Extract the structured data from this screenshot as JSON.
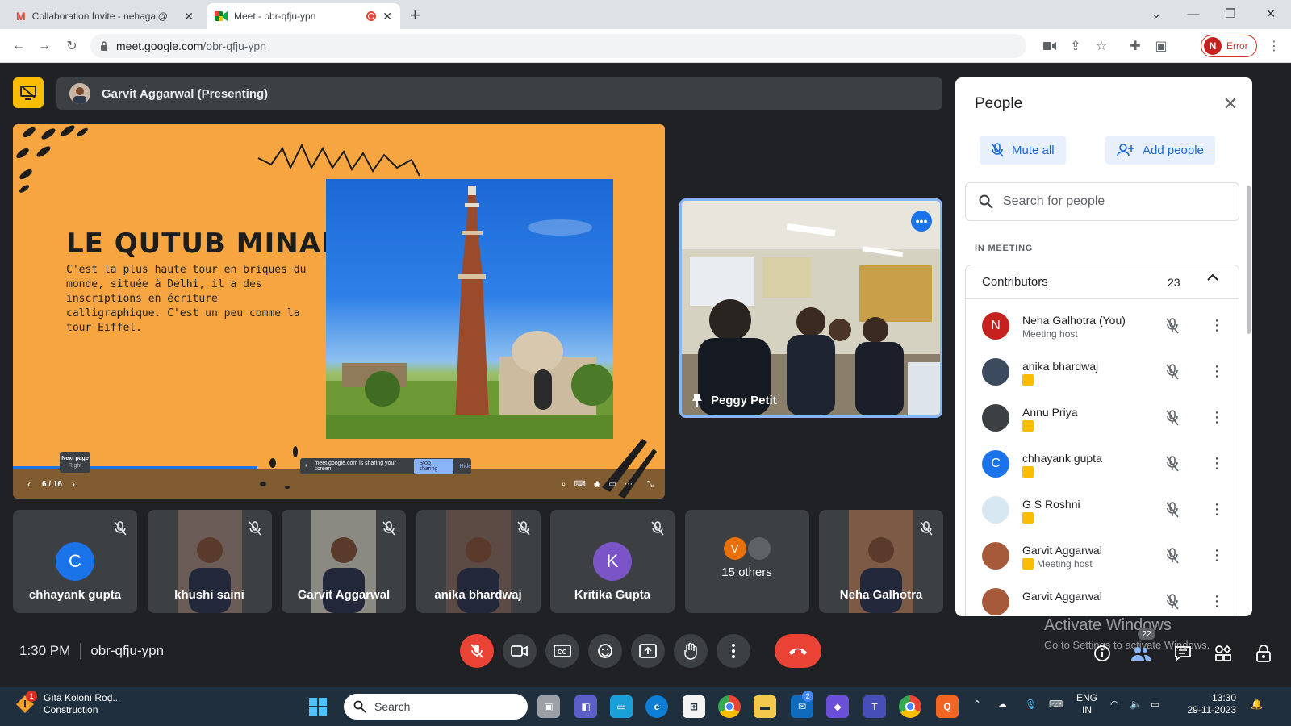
{
  "browser": {
    "tabs": [
      {
        "title": "Collaboration Invite - nehagal@",
        "active": false
      },
      {
        "title": "Meet - obr-qfju-ypn",
        "active": true
      }
    ],
    "new_tab": "+",
    "url_host": "meet.google.com",
    "url_path": "/obr-qfju-ypn",
    "profile_initial": "N",
    "profile_status": "Error"
  },
  "presentation": {
    "presenter": "Garvit Aggarwal (Presenting)"
  },
  "slide": {
    "title": "LE QUTUB MINAR",
    "text": "C'est la plus haute tour en briques du monde, située à Delhi, il a des inscriptions en écriture calligraphique. C'est un peu comme la tour Eiffel.",
    "page": "6 / 16",
    "tooltip_title": "Next page",
    "tooltip_key": "Right",
    "share_note": "meet.google.com is sharing your screen.",
    "stop_sharing": "Stop sharing",
    "hide": "Hide",
    "progress_fraction": 0.375
  },
  "pinned": {
    "name": "Peggy Petit"
  },
  "tiles": [
    {
      "name": "chhayank gupta",
      "initial": "C",
      "color": "#1a73e8",
      "type": "avatar"
    },
    {
      "name": "khushi saini",
      "type": "camera",
      "bg": "#6b5c58"
    },
    {
      "name": "Garvit Aggarwal",
      "type": "camera",
      "bg": "#8a8a82"
    },
    {
      "name": "anika bhardwaj",
      "type": "camera",
      "bg": "#5c4a44"
    },
    {
      "name": "Kritika Gupta",
      "initial": "K",
      "color": "#7b55c7",
      "type": "avatar"
    },
    {
      "name": "15 others",
      "initial": "V",
      "color": "#e8710a",
      "type": "others"
    },
    {
      "name": "Neha Galhotra",
      "type": "camera",
      "bg": "#7d5a46"
    }
  ],
  "bottom": {
    "time": "1:30 PM",
    "meeting_code": "obr-qfju-ypn",
    "people_count": "22",
    "watermark_title": "Activate Windows",
    "watermark_sub": "Go to Settings to activate Windows."
  },
  "people_panel": {
    "title": "People",
    "mute_all": "Mute all",
    "add_people": "Add people",
    "search_placeholder": "Search for people",
    "section": "IN MEETING",
    "group_title": "Contributors",
    "group_count": "23",
    "participants": [
      {
        "name": "Neha Galhotra (You)",
        "sub": "Meeting host",
        "initial": "N",
        "color": "#c5221f",
        "presenting": false
      },
      {
        "name": "anika bhardwaj",
        "sub": "",
        "initial": "",
        "color": "#3b4a5c",
        "presenting": true
      },
      {
        "name": "Annu Priya",
        "sub": "",
        "initial": "",
        "color": "#3c4043",
        "presenting": true
      },
      {
        "name": "chhayank gupta",
        "sub": "",
        "initial": "C",
        "color": "#1a73e8",
        "presenting": true
      },
      {
        "name": "G S Roshni",
        "sub": "",
        "initial": "",
        "color": "#d7e8f2",
        "presenting": true
      },
      {
        "name": "Garvit Aggarwal",
        "sub": "Meeting host",
        "initial": "",
        "color": "#a65a3a",
        "presenting": true
      },
      {
        "name": "Garvit Aggarwal",
        "sub": "",
        "initial": "",
        "color": "#a65a3a",
        "presenting": false
      }
    ]
  },
  "taskbar": {
    "weather_badge": "1",
    "weather_title": "Gītā Kōlonī Roḍ...",
    "weather_sub": "Construction",
    "search": "Search",
    "lang_top": "ENG",
    "lang_bottom": "IN",
    "clock_time": "13:30",
    "clock_date": "29-11-2023",
    "mail_badge": "2"
  },
  "colors": {
    "accent": "#1a73e8",
    "danger": "#ea4335",
    "present": "#fbbc04",
    "slide_bg": "#f7a540"
  }
}
